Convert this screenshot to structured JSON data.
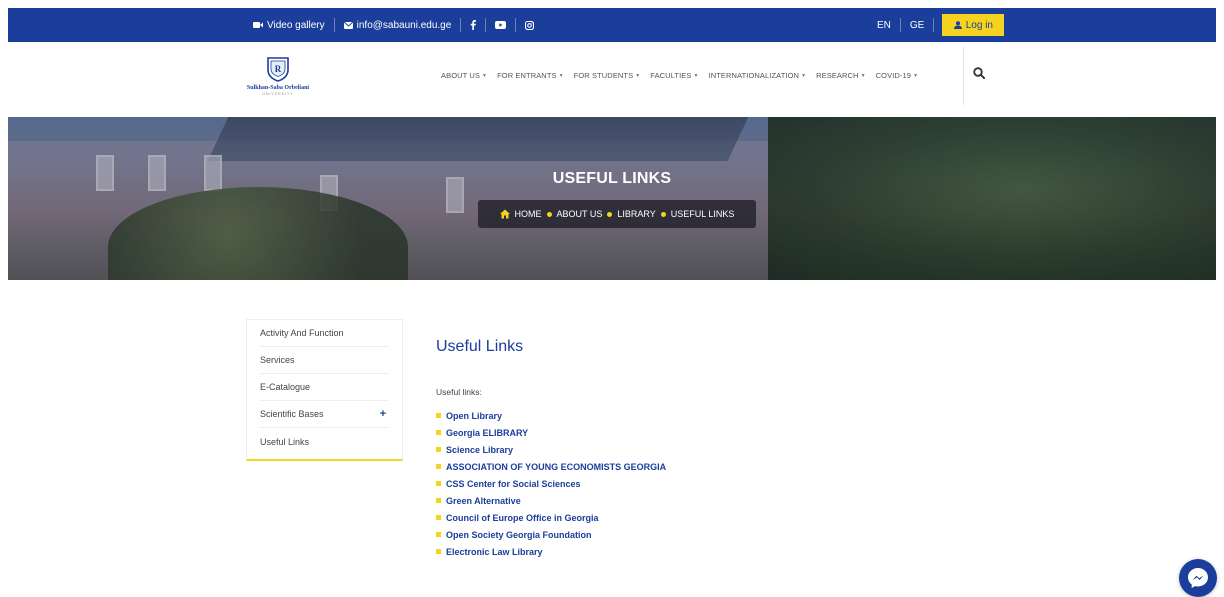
{
  "topbar": {
    "video_gallery": "Video gallery",
    "email": "info@sabauni.edu.ge",
    "lang_en": "EN",
    "lang_ge": "GE",
    "login": "Log in"
  },
  "nav": {
    "items": [
      "ABOUT US",
      "FOR ENTRANTS",
      "FOR STUDENTS",
      "FACULTIES",
      "INTERNATIONALIZATION",
      "RESEARCH",
      "COVID-19"
    ]
  },
  "logo": {
    "name": "Sulkhan-Saba Orbeliani",
    "sub": "UNIVERSITY"
  },
  "hero": {
    "title": "USEFUL LINKS",
    "breadcrumb": [
      "HOME",
      "ABOUT US",
      "LIBRARY",
      "USEFUL LINKS"
    ]
  },
  "sidebar": {
    "items": [
      "Activity And Function",
      "Services",
      "E-Catalogue",
      "Scientific Bases",
      "Useful Links"
    ]
  },
  "content": {
    "title": "Useful Links",
    "subtitle": "Useful links:",
    "links": [
      "Open Library",
      "Georgia ELIBRARY",
      "Science Library",
      "ASSOCIATION OF YOUNG ECONOMISTS GEORGIA",
      "CSS Center for Social Sciences",
      "Green Alternative",
      "Council of Europe Office in Georgia",
      "Open Society Georgia Foundation",
      "Electronic Law Library"
    ]
  },
  "colors": {
    "brand_blue": "#1b3e9b",
    "accent_yellow": "#f4d21f"
  }
}
